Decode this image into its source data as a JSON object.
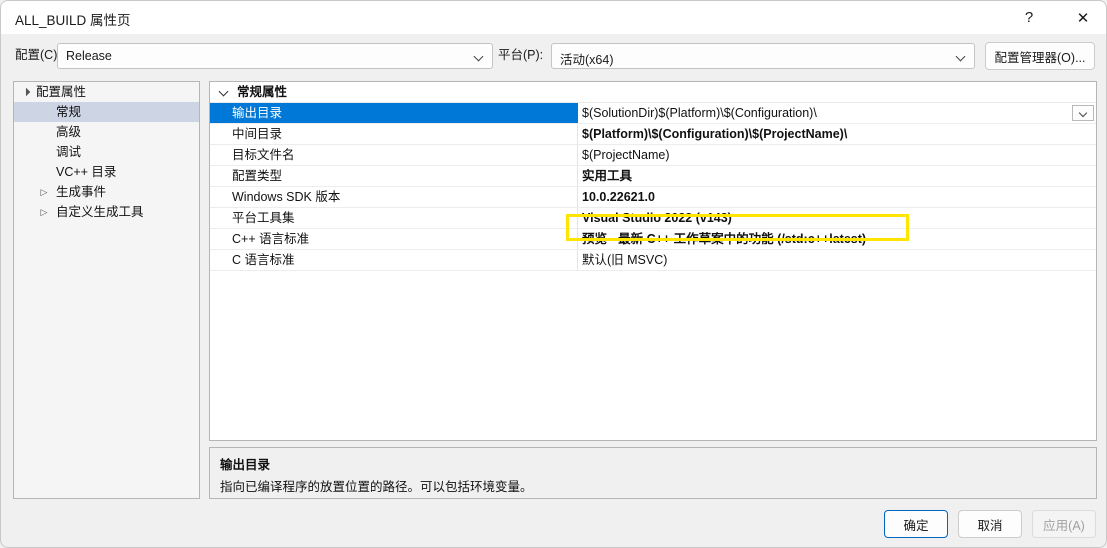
{
  "window": {
    "title": "ALL_BUILD 属性页",
    "help_label": "?",
    "close_label": "✕"
  },
  "config_bar": {
    "config_label": "配置(C):",
    "config_value": "Release",
    "platform_label": "平台(P):",
    "platform_value": "活动(x64)",
    "config_manager_button": "配置管理器(O)..."
  },
  "tree": {
    "items": [
      {
        "label": "配置属性",
        "level": 0,
        "twisty": "▲",
        "selected": false
      },
      {
        "label": "常规",
        "level": 1,
        "twisty": "",
        "selected": true
      },
      {
        "label": "高级",
        "level": 1,
        "twisty": "",
        "selected": false
      },
      {
        "label": "调试",
        "level": 1,
        "twisty": "",
        "selected": false
      },
      {
        "label": "VC++ 目录",
        "level": 1,
        "twisty": "",
        "selected": false
      },
      {
        "label": "生成事件",
        "level": 1,
        "twisty": "▷",
        "selected": false
      },
      {
        "label": "自定义生成工具",
        "level": 1,
        "twisty": "▷",
        "selected": false
      }
    ]
  },
  "grid": {
    "group_label": "常规属性",
    "rows": [
      {
        "name": "输出目录",
        "value": "$(SolutionDir)$(Platform)\\$(Configuration)\\",
        "bold": false,
        "selected": true,
        "dropdown": true
      },
      {
        "name": "中间目录",
        "value": "$(Platform)\\$(Configuration)\\$(ProjectName)\\",
        "bold": true,
        "selected": false,
        "dropdown": false
      },
      {
        "name": "目标文件名",
        "value": "$(ProjectName)",
        "bold": false,
        "selected": false,
        "dropdown": false
      },
      {
        "name": "配置类型",
        "value": "实用工具",
        "bold": true,
        "selected": false,
        "dropdown": false
      },
      {
        "name": "Windows SDK 版本",
        "value": "10.0.22621.0",
        "bold": true,
        "selected": false,
        "dropdown": false
      },
      {
        "name": "平台工具集",
        "value": "Visual Studio 2022 (v143)",
        "bold": true,
        "selected": false,
        "dropdown": false
      },
      {
        "name": "C++ 语言标准",
        "value": "预览 - 最新 C++ 工作草案中的功能 (/std:c++latest)",
        "bold": true,
        "selected": false,
        "dropdown": false
      },
      {
        "name": "C 语言标准",
        "value": "默认(旧 MSVC)",
        "bold": false,
        "selected": false,
        "dropdown": false
      }
    ]
  },
  "description": {
    "title": "输出目录",
    "body": "指向已编译程序的放置位置的路径。可以包括环境变量。"
  },
  "footer": {
    "ok_label": "确定",
    "cancel_label": "取消",
    "apply_label": "应用(A)"
  },
  "colors": {
    "selection_blue": "#0078d7",
    "highlight_yellow": "#ffe500",
    "focus_border": "#0067c0"
  }
}
